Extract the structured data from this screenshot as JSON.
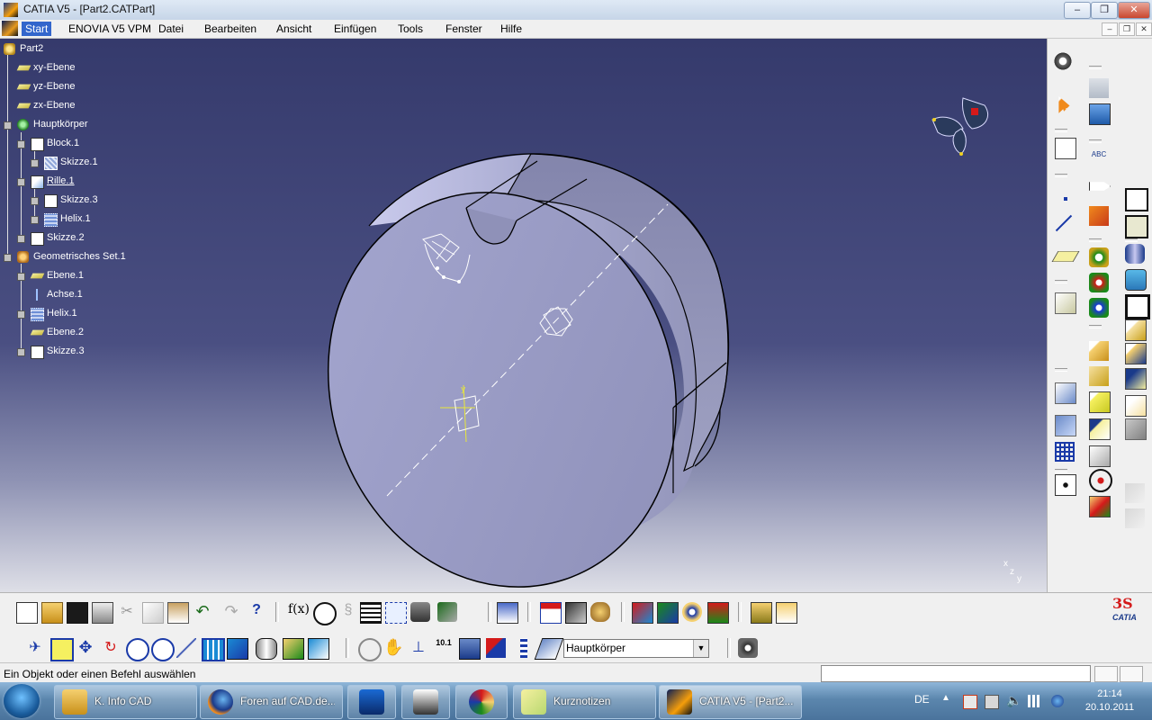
{
  "window": {
    "title": "CATIA V5 - [Part2.CATPart]",
    "controls": {
      "minimize": "–",
      "restore": "❐",
      "close": "✕"
    }
  },
  "menu": {
    "items": [
      {
        "label": "Start",
        "active": true
      },
      {
        "label": "ENOVIA V5 VPM"
      },
      {
        "label": "Datei"
      },
      {
        "label": "Bearbeiten"
      },
      {
        "label": "Ansicht"
      },
      {
        "label": "Einfügen"
      },
      {
        "label": "Tools"
      },
      {
        "label": "Fenster"
      },
      {
        "label": "Hilfe"
      }
    ],
    "doc_controls": {
      "minimize": "–",
      "restore": "❐",
      "close": "✕"
    }
  },
  "tree": [
    {
      "label": "Part2",
      "icon": "part-icon"
    },
    {
      "label": "xy-Ebene",
      "icon": "plane-icon"
    },
    {
      "label": "yz-Ebene",
      "icon": "plane-icon"
    },
    {
      "label": "zx-Ebene",
      "icon": "plane-icon"
    },
    {
      "label": "Hauptkörper",
      "icon": "body-icon"
    },
    {
      "label": "Block.1",
      "icon": "pad-icon"
    },
    {
      "label": "Skizze.1",
      "icon": "sketch-icon"
    },
    {
      "label": "Rille.1",
      "icon": "groove-icon"
    },
    {
      "label": "Skizze.3",
      "icon": "sketch-small-icon"
    },
    {
      "label": "Helix.1",
      "icon": "helix-icon"
    },
    {
      "label": "Skizze.2",
      "icon": "sketch-small-icon"
    },
    {
      "label": "Geometrisches Set.1",
      "icon": "geometrical-set-icon"
    },
    {
      "label": "Ebene.1",
      "icon": "plane-icon"
    },
    {
      "label": "Achse.1",
      "icon": "axis-icon"
    },
    {
      "label": "Helix.1",
      "icon": "helix-icon"
    },
    {
      "label": "Ebene.2",
      "icon": "plane-icon"
    },
    {
      "label": "Skizze.3",
      "icon": "sketch-small-icon"
    }
  ],
  "compass_axes": {
    "x": "x",
    "y": "y",
    "z": "z"
  },
  "toolbar": {
    "current_body": "Hauptkörper",
    "formula_label": "f(x)",
    "measure_label": "10.1"
  },
  "status": {
    "message": "Ein Objekt oder einen Befehl auswählen",
    "command_input": ""
  },
  "brand": {
    "logo_text": "CATIA"
  },
  "taskbar": {
    "tasks": [
      {
        "label": "K. Info CAD",
        "icon": "folder-icon"
      },
      {
        "label": "Foren auf CAD.de...",
        "icon": "firefox-icon"
      },
      {
        "label": "",
        "icon": "pin-app-icon"
      },
      {
        "label": "",
        "icon": "media-player-icon"
      },
      {
        "label": "",
        "icon": "paint-icon"
      },
      {
        "label": "Kurznotizen",
        "icon": "sticky-notes-icon"
      },
      {
        "label": "CATIA V5 - [Part2....",
        "icon": "catia-icon",
        "active": true
      }
    ],
    "language": "DE",
    "time": "21:14",
    "date": "20.10.2011"
  },
  "colors": {
    "viewport_top": "#353a6c",
    "viewport_bottom": "#dedfe7",
    "part_face": "#9b9dc6",
    "tree_text": "#ffffff",
    "taskbar": "#5b86ad"
  }
}
